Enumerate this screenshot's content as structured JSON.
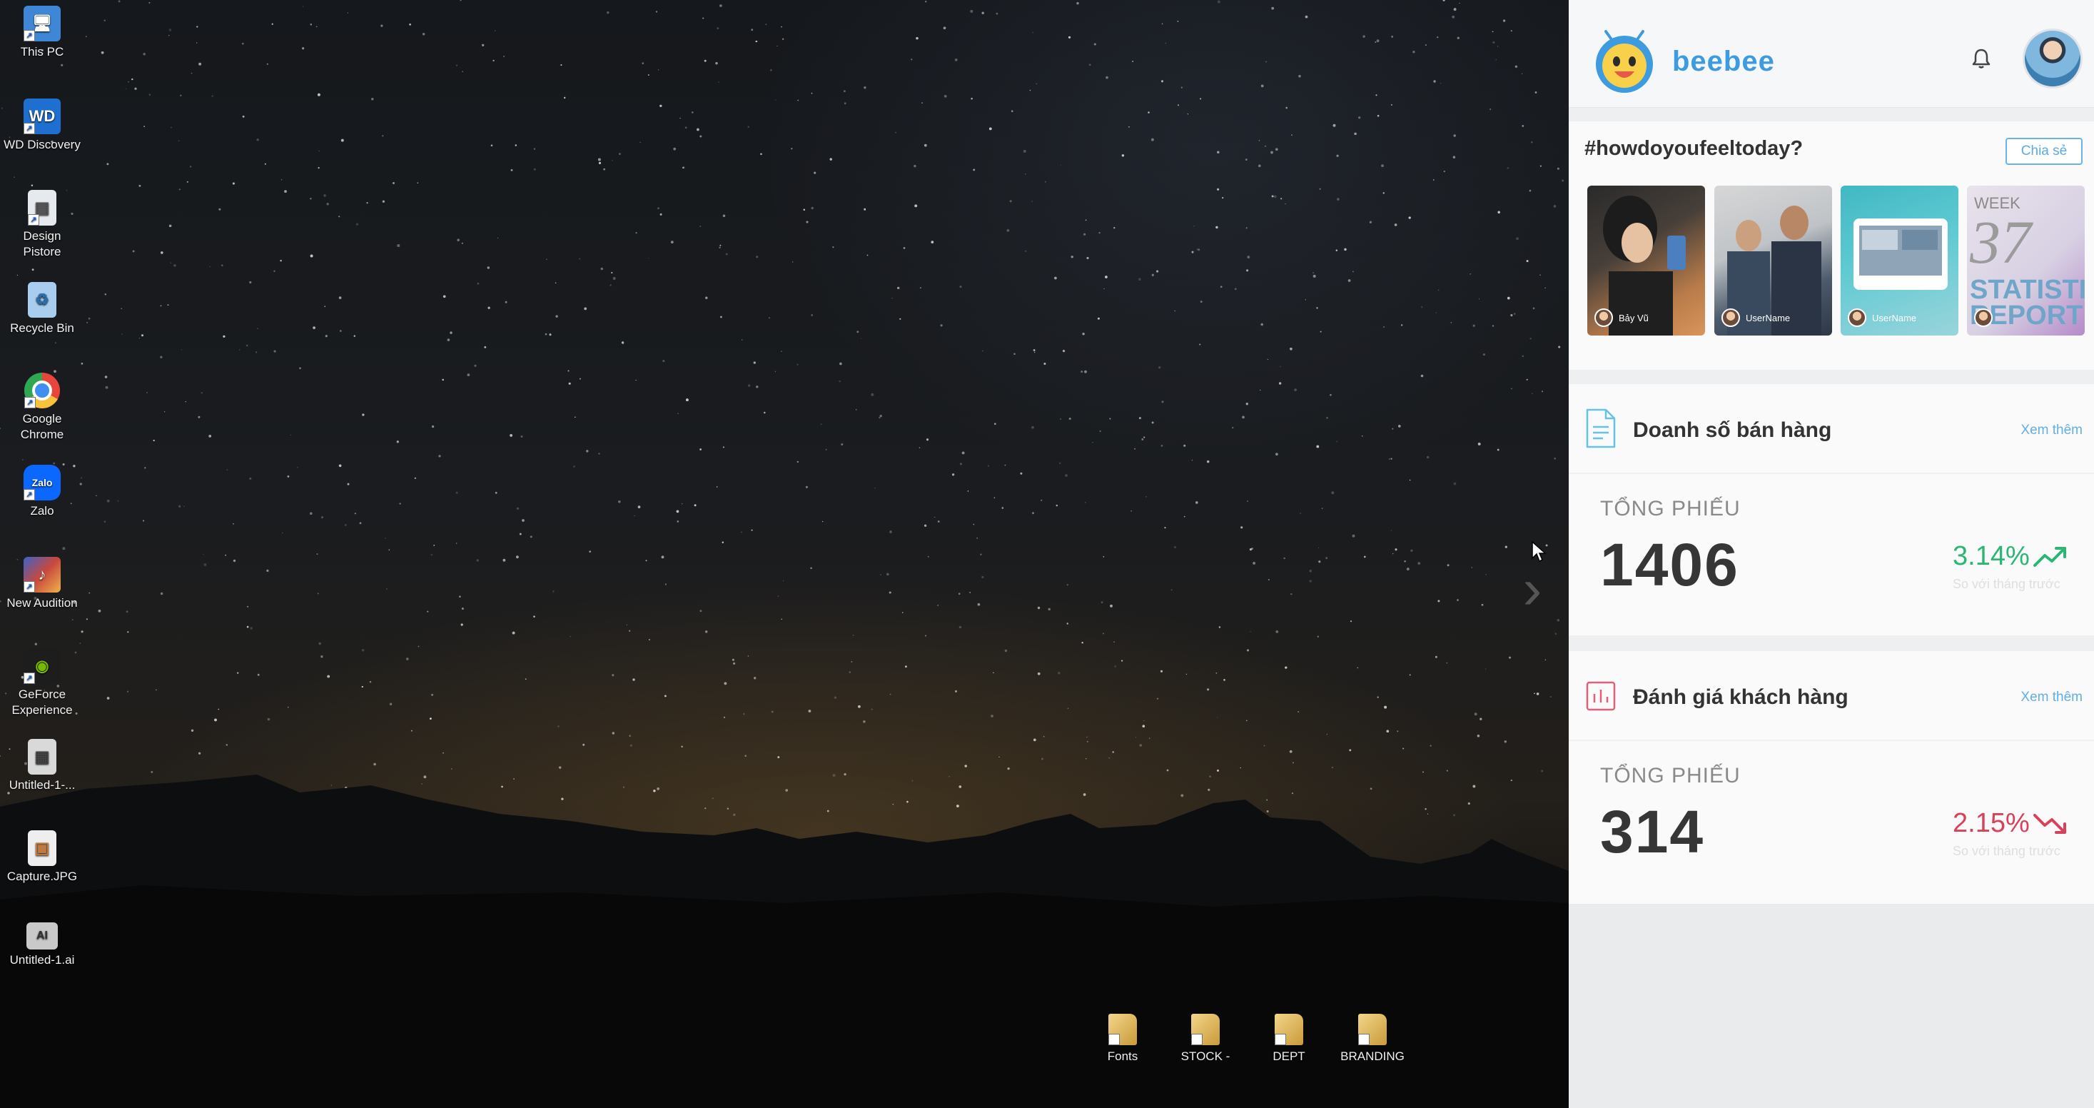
{
  "desktop": {
    "icons": [
      {
        "label": "This PC",
        "icon": "monitor-icon",
        "color": "#4a8fd8"
      },
      {
        "label": "WD Discovery",
        "icon": "wd-icon",
        "color": "#1e6fcf"
      },
      {
        "label": "Design Pistore",
        "icon": "document-icon",
        "color": "#dfe3e8"
      },
      {
        "label": "Recycle Bin",
        "icon": "recycle-bin-icon",
        "color": "#9fc6e8"
      },
      {
        "label": "Google Chrome",
        "icon": "chrome-icon",
        "color": "#e8453c"
      },
      {
        "label": "Zalo",
        "icon": "zalo-icon",
        "color": "#0a68ff"
      },
      {
        "label": "New Audition",
        "icon": "audition-icon",
        "color": "#c8483e"
      },
      {
        "label": "GeForce Experience",
        "icon": "geforce-icon",
        "color": "#76b900"
      },
      {
        "label": "Untitled-1-...",
        "icon": "file-icon",
        "color": "#8a8a8a"
      },
      {
        "label": "Capture.JPG",
        "icon": "image-file-icon",
        "color": "#c07a3e"
      },
      {
        "label": "Untitled-1.ai",
        "icon": "ai-file-icon",
        "color": "#b0b0b0"
      }
    ],
    "bottom_folders": [
      {
        "label": "Fonts"
      },
      {
        "label": "STOCK -"
      },
      {
        "label": "DEPT"
      },
      {
        "label": "BRANDING"
      }
    ]
  },
  "app": {
    "name": "beebee",
    "brand_color": "#3d9be0",
    "feel": {
      "title": "#howdoyoufeeltoday?",
      "share_label": "Chia sẻ",
      "stories": [
        {
          "user": "Bảy Vũ"
        },
        {
          "user": "UserName"
        },
        {
          "user": "UserName"
        },
        {
          "user": "",
          "week_label": "WEEK",
          "week_number": "37",
          "banner": "STATISTI REPORT"
        }
      ]
    },
    "sales": {
      "title": "Doanh số bán hàng",
      "more": "Xem thêm",
      "subtitle": "TỔNG PHIẾU",
      "value": "1406",
      "change": "3.14%",
      "trend": "up",
      "trend_color": "#2bb673",
      "note": "So với tháng trước"
    },
    "reviews": {
      "title": "Đánh giá khách hàng",
      "more": "Xem thêm",
      "subtitle": "TỔNG PHIẾU",
      "value": "314",
      "change": "2.15%",
      "trend": "down",
      "trend_color": "#d9405a",
      "note": "So với tháng trước"
    }
  }
}
